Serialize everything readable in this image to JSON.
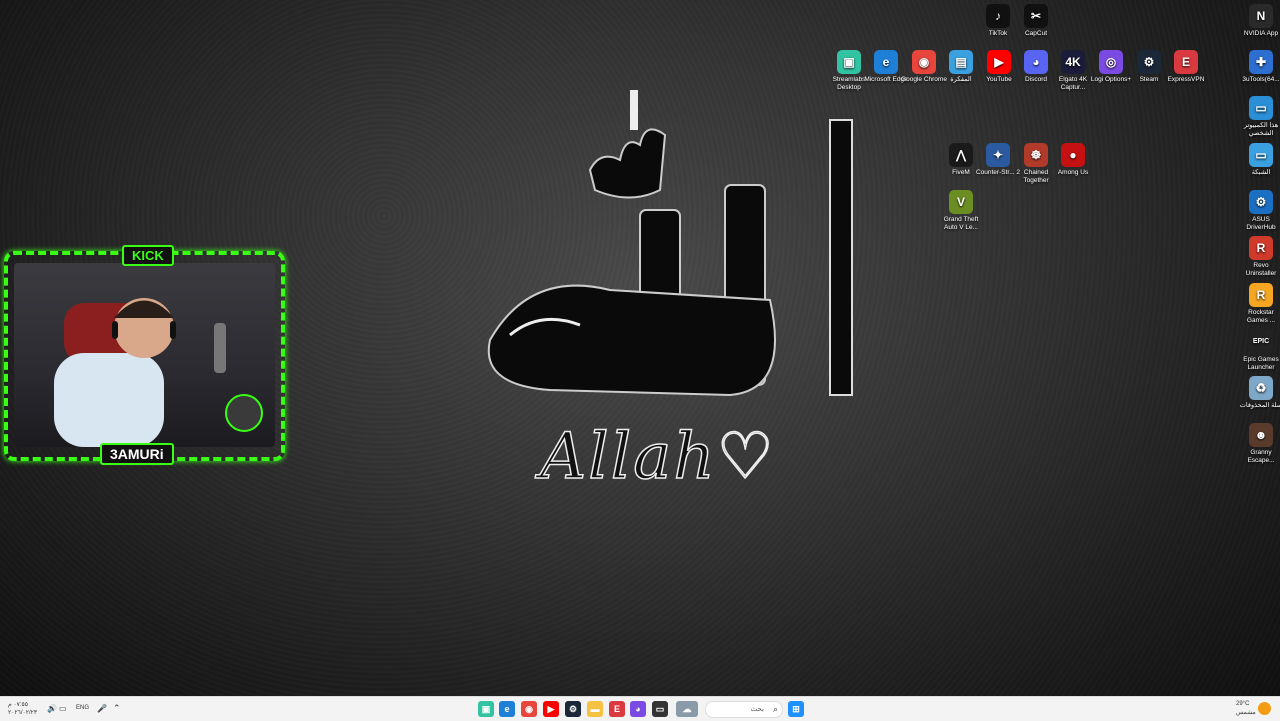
{
  "desktop": {
    "icons_top_row": [
      {
        "label": "TikTok",
        "color": "#111111",
        "glyph": "♪"
      },
      {
        "label": "CapCut",
        "color": "#111111",
        "glyph": "✂"
      },
      {
        "label": "NVIDIA App",
        "color": "#2a2a2a",
        "glyph": "N"
      }
    ],
    "icons_row2": [
      {
        "label": "Streamlabs Desktop",
        "color": "#31c3a2",
        "glyph": "▣"
      },
      {
        "label": "Microsoft Edge",
        "color": "#1e7fd6",
        "glyph": "e"
      },
      {
        "label": "Google Chrome",
        "color": "#e8453c",
        "glyph": "◉"
      },
      {
        "label": "المفكرة",
        "color": "#3aa0e0",
        "glyph": "▤"
      },
      {
        "label": "YouTube",
        "color": "#ff0000",
        "glyph": "▶"
      },
      {
        "label": "Discord",
        "color": "#5865f2",
        "glyph": "◕"
      },
      {
        "label": "Elgato 4K Captur...",
        "color": "#1b1b3a",
        "glyph": "4K"
      },
      {
        "label": "Logi Options+",
        "color": "#7b4ae2",
        "glyph": "◎"
      },
      {
        "label": "Steam",
        "color": "#1b2838",
        "glyph": "⚙"
      },
      {
        "label": "ExpressVPN",
        "color": "#da3940",
        "glyph": "E"
      }
    ],
    "icons_games": [
      {
        "label": "FiveM",
        "color": "#1a1a1a",
        "glyph": "⋀"
      },
      {
        "label": "Counter-Str... 2",
        "color": "#2c5aa0",
        "glyph": "✦"
      },
      {
        "label": "Chained Together",
        "color": "#b23a2a",
        "glyph": "☸"
      },
      {
        "label": "Among Us",
        "color": "#c51111",
        "glyph": "●"
      },
      {
        "label": "Grand Theft Auto V Le...",
        "color": "#6b8e23",
        "glyph": "V"
      }
    ],
    "icons_right": [
      {
        "label": "3uTools(64...",
        "color": "#2d6fd1",
        "glyph": "✚"
      },
      {
        "label": "هذا الكمبيوتر الشخصي",
        "color": "#2a8fd6",
        "glyph": "▭"
      },
      {
        "label": "الشبكة",
        "color": "#3aa0e0",
        "glyph": "▭"
      },
      {
        "label": "ASUS DriverHub",
        "color": "#1b6fc2",
        "glyph": "⚙"
      },
      {
        "label": "Revo Uninstaller",
        "color": "#d03a2a",
        "glyph": "R"
      },
      {
        "label": "Rockstar Games ...",
        "color": "#f5a623",
        "glyph": "R"
      },
      {
        "label": "Epic Games Launcher",
        "color": "#222222",
        "glyph": "EPIC"
      },
      {
        "label": "سلة المحذوفات",
        "color": "#7ea8c8",
        "glyph": "♻"
      },
      {
        "label": "Granny Escape...",
        "color": "#5a3a2a",
        "glyph": "☻"
      }
    ],
    "wallpaper_text": "Allah♡"
  },
  "webcam": {
    "badge_top": "KICK",
    "badge_name": "3AMURi"
  },
  "taskbar": {
    "clock_time": "٠٧:٥٥ م",
    "clock_date": "٢٠٢٦/٠٢/٢٣",
    "lang": "ENG",
    "search_placeholder": "بحث",
    "weather_temp": "29°C",
    "weather_desc": "مشمس"
  }
}
